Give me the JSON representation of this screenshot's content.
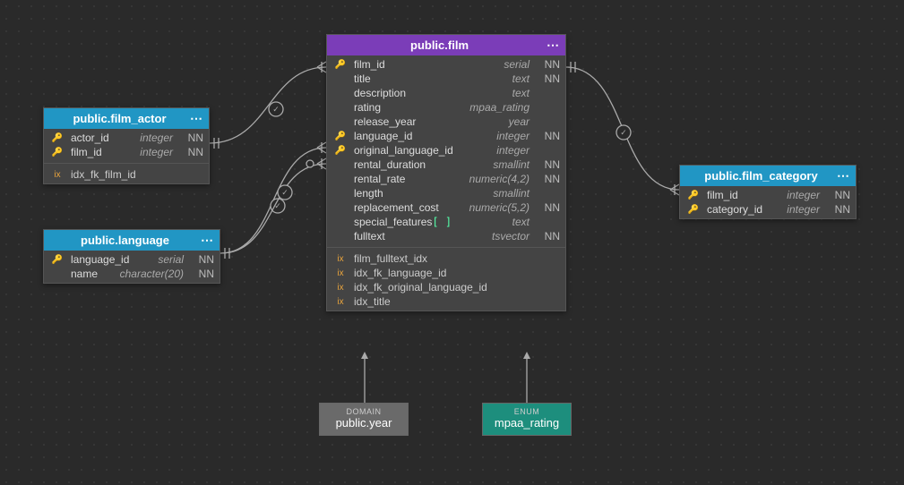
{
  "tables": {
    "film": {
      "title": "public.film",
      "headerColor": "purple",
      "columns": [
        {
          "key": "pk",
          "name": "film_id",
          "type": "serial",
          "nn": "NN"
        },
        {
          "key": "",
          "name": "title",
          "type": "text",
          "nn": "NN"
        },
        {
          "key": "",
          "name": "description",
          "type": "text",
          "nn": ""
        },
        {
          "key": "",
          "name": "rating",
          "type": "mpaa_rating",
          "nn": ""
        },
        {
          "key": "",
          "name": "release_year",
          "type": "year",
          "nn": ""
        },
        {
          "key": "fk",
          "name": "language_id",
          "type": "integer",
          "nn": "NN"
        },
        {
          "key": "fk",
          "name": "original_language_id",
          "type": "integer",
          "nn": ""
        },
        {
          "key": "",
          "name": "rental_duration",
          "type": "smallint",
          "nn": "NN"
        },
        {
          "key": "",
          "name": "rental_rate",
          "type": "numeric(4,2)",
          "nn": "NN"
        },
        {
          "key": "",
          "name": "length",
          "type": "smallint",
          "nn": ""
        },
        {
          "key": "",
          "name": "replacement_cost",
          "type": "numeric(5,2)",
          "nn": "NN"
        },
        {
          "key": "",
          "name": "special_features",
          "type": "text",
          "nn": "",
          "array": true
        },
        {
          "key": "",
          "name": "fulltext",
          "type": "tsvector",
          "nn": "NN"
        }
      ],
      "indexes": [
        {
          "name": "film_fulltext_idx"
        },
        {
          "name": "idx_fk_language_id"
        },
        {
          "name": "idx_fk_original_language_id"
        },
        {
          "name": "idx_title"
        }
      ]
    },
    "film_actor": {
      "title": "public.film_actor",
      "headerColor": "blue",
      "columns": [
        {
          "key": "pk",
          "name": "actor_id",
          "type": "integer",
          "nn": "NN"
        },
        {
          "key": "pk",
          "name": "film_id",
          "type": "integer",
          "nn": "NN"
        }
      ],
      "indexes": [
        {
          "name": "idx_fk_film_id"
        }
      ]
    },
    "language": {
      "title": "public.language",
      "headerColor": "blue",
      "columns": [
        {
          "key": "pk",
          "name": "language_id",
          "type": "serial",
          "nn": "NN"
        },
        {
          "key": "",
          "name": "name",
          "type": "character(20)",
          "nn": "NN"
        }
      ],
      "indexes": []
    },
    "film_category": {
      "title": "public.film_category",
      "headerColor": "blue",
      "columns": [
        {
          "key": "pk",
          "name": "film_id",
          "type": "integer",
          "nn": "NN"
        },
        {
          "key": "pk",
          "name": "category_id",
          "type": "integer",
          "nn": "NN"
        }
      ],
      "indexes": []
    }
  },
  "types": {
    "domain": {
      "label": "DOMAIN",
      "name": "public.year"
    },
    "enum": {
      "label": "ENUM",
      "name": "mpaa_rating"
    }
  },
  "ui": {
    "menu": "⋯"
  }
}
